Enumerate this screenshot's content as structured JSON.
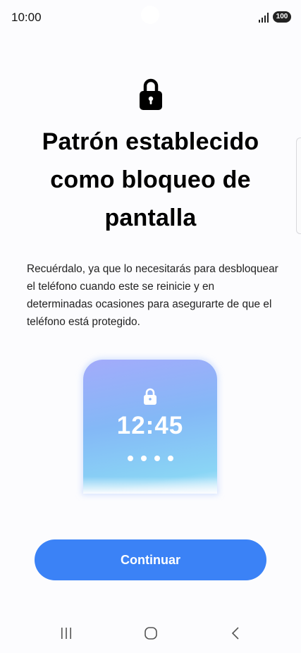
{
  "status_bar": {
    "time": "10:00",
    "battery": "100",
    "icons": [
      "signal-icon"
    ]
  },
  "header": {
    "icon": "lock-icon",
    "title": "Patrón establecido como bloqueo de pantalla"
  },
  "body": {
    "description": "Recuérdalo, ya que lo necesitarás para desbloquear el teléfono cuando este se reinicie y en determinadas ocasiones para asegurarte de que el teléfono está protegido."
  },
  "preview": {
    "icon": "lock-icon",
    "time": "12:45",
    "pin_dots": 4
  },
  "actions": {
    "continue_label": "Continuar"
  },
  "nav_bar": {
    "icons": [
      "recents-icon",
      "home-icon",
      "back-icon"
    ]
  },
  "colors": {
    "accent": "#3b82f6",
    "background": "#fcfcfe",
    "card_gradient_top": "#a3abfb",
    "card_gradient_bottom": "#8ad5f5"
  }
}
